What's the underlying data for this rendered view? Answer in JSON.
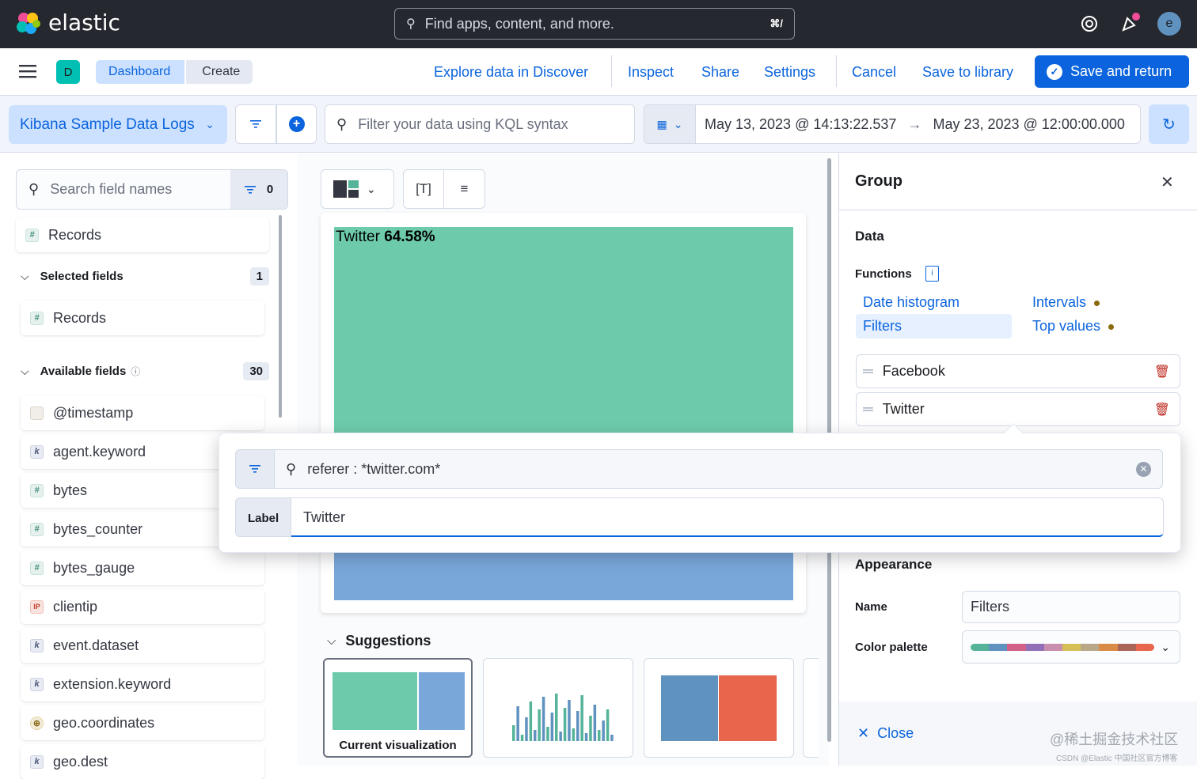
{
  "header": {
    "brand": "elastic",
    "search_placeholder": "Find apps, content, and more.",
    "search_shortcut": "⌘/",
    "avatar_letter": "e"
  },
  "nav": {
    "space_letter": "D",
    "breadcrumbs": [
      "Dashboard",
      "Create"
    ],
    "actions": {
      "explore": "Explore data in Discover",
      "inspect": "Inspect",
      "share": "Share",
      "settings": "Settings",
      "cancel": "Cancel",
      "save_library": "Save to library",
      "save_return": "Save and return"
    }
  },
  "query_bar": {
    "data_view": "Kibana Sample Data Logs",
    "kql_placeholder": "Filter your data using KQL syntax",
    "time_start": "May 13, 2023 @ 14:13:22.537",
    "time_end": "May 23, 2023 @ 12:00:00.000"
  },
  "field_list": {
    "search_placeholder": "Search field names",
    "filter_count": "0",
    "records": "Records",
    "selected_title": "Selected fields",
    "selected_count": "1",
    "selected_fields": [
      "Records"
    ],
    "available_title": "Available fields",
    "available_count": "30",
    "available_fields": [
      {
        "name": "@timestamp",
        "type": "date",
        "badge": ""
      },
      {
        "name": "agent.keyword",
        "type": "keyword",
        "badge": "k"
      },
      {
        "name": "bytes",
        "type": "number",
        "badge": "#"
      },
      {
        "name": "bytes_counter",
        "type": "number",
        "badge": "#"
      },
      {
        "name": "bytes_gauge",
        "type": "number",
        "badge": "#"
      },
      {
        "name": "clientip",
        "type": "ip",
        "badge": "IP"
      },
      {
        "name": "event.dataset",
        "type": "keyword",
        "badge": "k"
      },
      {
        "name": "extension.keyword",
        "type": "keyword",
        "badge": "k"
      },
      {
        "name": "geo.coordinates",
        "type": "geo",
        "badge": "⊕"
      },
      {
        "name": "geo.dest",
        "type": "keyword",
        "badge": "k"
      }
    ]
  },
  "workspace": {
    "treemap_label_name": "Twitter",
    "treemap_label_value": "64.58%",
    "suggestions_title": "Suggestions",
    "suggestion_current": "Current visualization"
  },
  "chart_data": {
    "type": "heatmap",
    "series": [
      {
        "name": "Twitter",
        "value": 64.58
      },
      {
        "name": "Facebook",
        "value": 35.42
      }
    ]
  },
  "group_panel": {
    "title": "Group",
    "data_title": "Data",
    "functions_label": "Functions",
    "functions": [
      "Date histogram",
      "Intervals",
      "Filters",
      "Top values"
    ],
    "filters": [
      "Facebook",
      "Twitter"
    ],
    "appearance_title": "Appearance",
    "name_label": "Name",
    "name_value": "Filters",
    "palette_label": "Color palette",
    "close": "Close",
    "palette_colors": [
      "#54b399",
      "#6092c0",
      "#d36086",
      "#9170b8",
      "#ca8eae",
      "#d6bf57",
      "#b9a888",
      "#da8b45",
      "#aa6556",
      "#e7664c"
    ]
  },
  "filter_popover": {
    "query": "referer : *twitter.com*",
    "label_prefix": "Label",
    "label_value": "Twitter"
  },
  "watermark": {
    "line1": "@稀土掘金技术社区",
    "line2": "CSDN @Elastic 中国社区官方博客"
  }
}
